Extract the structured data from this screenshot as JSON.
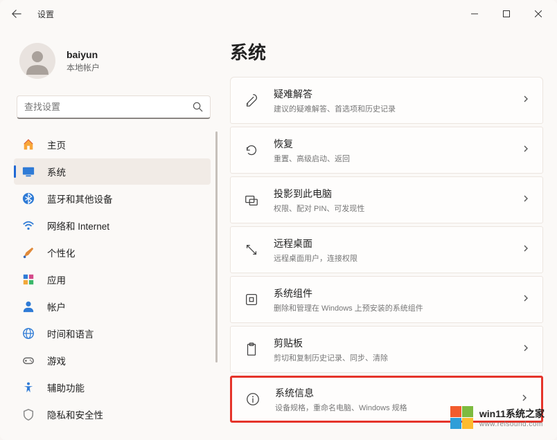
{
  "window": {
    "title_label": "设置"
  },
  "user": {
    "name": "baiyun",
    "subtitle": "本地帐户"
  },
  "search": {
    "placeholder": "查找设置"
  },
  "sidebar": {
    "items": [
      {
        "label": "主页",
        "icon": "home-icon",
        "color_a": "#f8a63a",
        "color_b": "#d44a2c"
      },
      {
        "label": "系统",
        "icon": "display-icon",
        "color_a": "#2f7bd6",
        "color_b": "#2f7bd6"
      },
      {
        "label": "蓝牙和其他设备",
        "icon": "bluetooth-icon",
        "color_a": "#2f7bd6"
      },
      {
        "label": "网络和 Internet",
        "icon": "wifi-icon",
        "color_a": "#2f7bd6"
      },
      {
        "label": "个性化",
        "icon": "brush-icon",
        "color_a": "#e08a3a"
      },
      {
        "label": "应用",
        "icon": "apps-icon",
        "color_a": "#2f7bd6"
      },
      {
        "label": "帐户",
        "icon": "person-icon",
        "color_a": "#2f7bd6"
      },
      {
        "label": "时间和语言",
        "icon": "globe-icon",
        "color_a": "#2f7bd6"
      },
      {
        "label": "游戏",
        "icon": "gamepad-icon",
        "color_a": "#666"
      },
      {
        "label": "辅助功能",
        "icon": "accessibility-icon",
        "color_a": "#2f7bd6"
      },
      {
        "label": "隐私和安全性",
        "icon": "shield-icon",
        "color_a": "#888"
      }
    ],
    "active_index": 1
  },
  "page": {
    "title": "系统",
    "cards": [
      {
        "title": "疑难解答",
        "sub": "建议的疑难解答、首选项和历史记录",
        "icon": "wrench"
      },
      {
        "title": "恢复",
        "sub": "重置、高级启动、返回",
        "icon": "recovery"
      },
      {
        "title": "投影到此电脑",
        "sub": "权限、配对 PIN、可发现性",
        "icon": "project"
      },
      {
        "title": "远程桌面",
        "sub": "远程桌面用户，连接权限",
        "icon": "remote"
      },
      {
        "title": "系统组件",
        "sub": "删除和管理在 Windows 上预安装的系统组件",
        "icon": "components"
      },
      {
        "title": "剪贴板",
        "sub": "剪切和复制历史记录、同步、清除",
        "icon": "clipboard"
      },
      {
        "title": "系统信息",
        "sub": "设备规格，重命名电脑、Windows 规格",
        "icon": "info"
      }
    ],
    "highlighted_index": 6
  },
  "watermark": {
    "main": "win11系统之家",
    "sub": "www.relsound.com"
  }
}
